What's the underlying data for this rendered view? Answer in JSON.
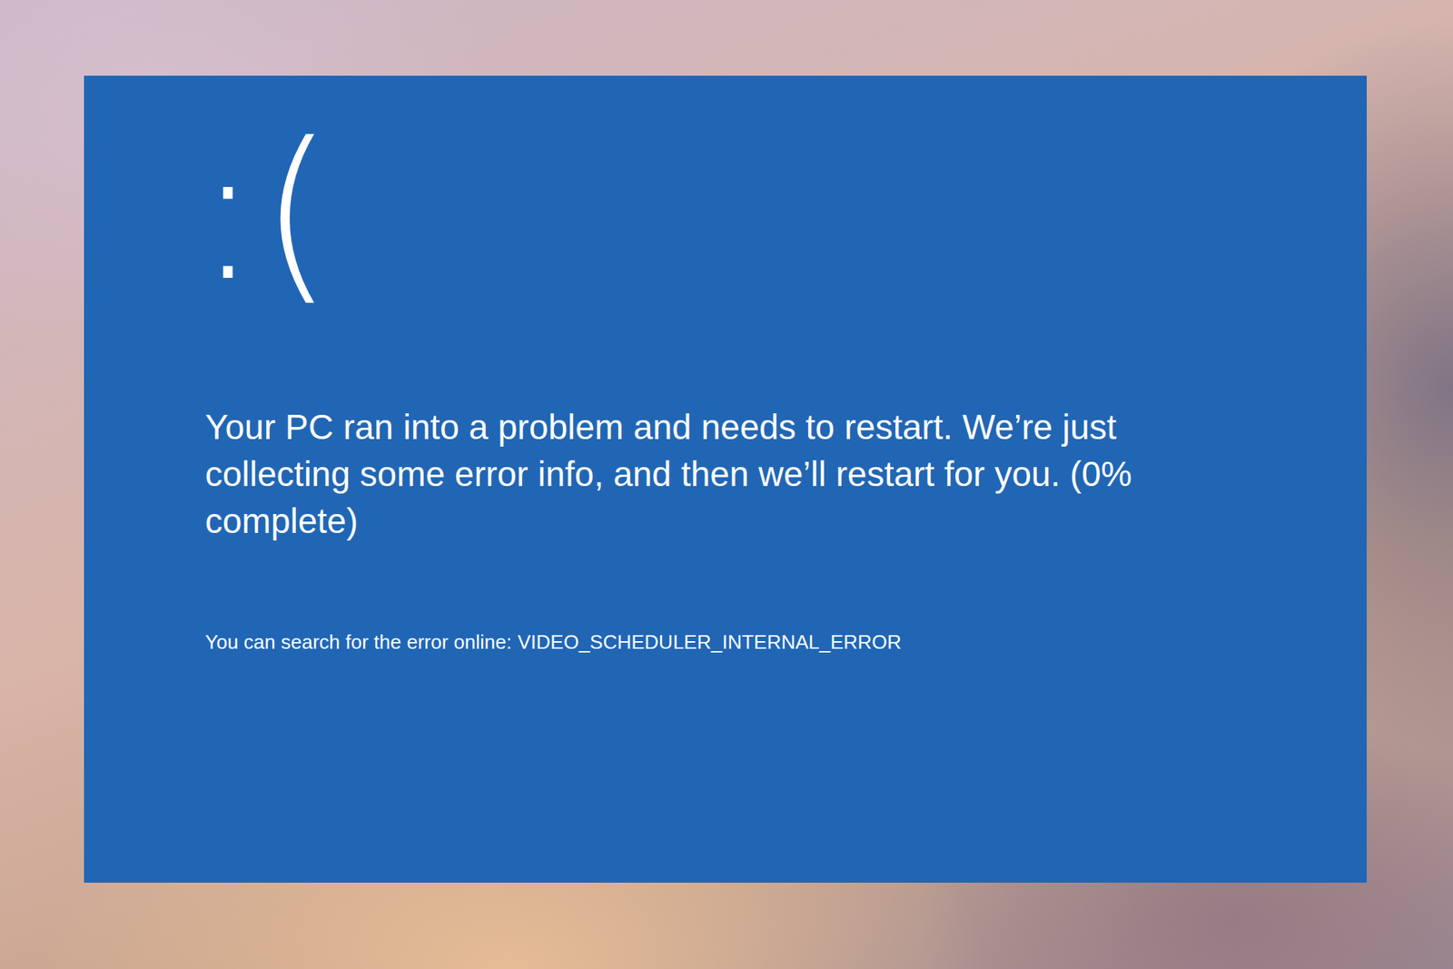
{
  "background_photo": {},
  "screen": {
    "face": ":(",
    "message": "Your PC ran into a problem and needs to restart. We’re just collecting some error info, and then we’ll restart for you. (0% complete)",
    "search_label": "You can search for the error online:",
    "stop_code": "VIDEO_SCHEDULER_INTERNAL_ERROR"
  }
}
